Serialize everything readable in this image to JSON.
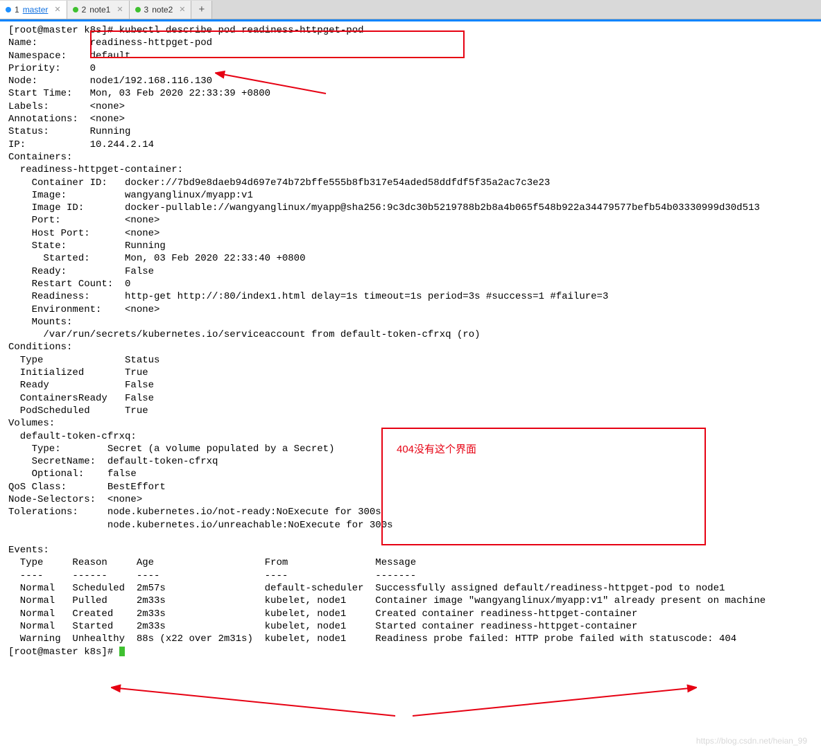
{
  "tabs": [
    {
      "num": "1",
      "title": "master",
      "active": true,
      "dot": "blue"
    },
    {
      "num": "2",
      "title": "note1",
      "active": false,
      "dot": "green"
    },
    {
      "num": "3",
      "title": "note2",
      "active": false,
      "dot": "green"
    }
  ],
  "term": {
    "prompt": "[root@master k8s]# ",
    "cmd": "kubectl describe pod readiness-httpget-pod",
    "body": "Name:         readiness-httpget-pod\nNamespace:    default\nPriority:     0\nNode:         node1/192.168.116.130\nStart Time:   Mon, 03 Feb 2020 22:33:39 +0800\nLabels:       <none>\nAnnotations:  <none>\nStatus:       Running\nIP:           10.244.2.14\nContainers:\n  readiness-httpget-container:\n    Container ID:   docker://7bd9e8daeb94d697e74b72bffe555b8fb317e54aded58ddfdf5f35a2ac7c3e23\n    Image:          wangyanglinux/myapp:v1\n    Image ID:       docker-pullable://wangyanglinux/myapp@sha256:9c3dc30b5219788b2b8a4b065f548b922a34479577befb54b03330999d30d513\n    Port:           <none>\n    Host Port:      <none>\n    State:          Running\n      Started:      Mon, 03 Feb 2020 22:33:40 +0800\n    Ready:          False\n    Restart Count:  0\n    Readiness:      http-get http://:80/index1.html delay=1s timeout=1s period=3s #success=1 #failure=3\n    Environment:    <none>\n    Mounts:\n      /var/run/secrets/kubernetes.io/serviceaccount from default-token-cfrxq (ro)\nConditions:\n  Type              Status\n  Initialized       True \n  Ready             False \n  ContainersReady   False \n  PodScheduled      True \nVolumes:\n  default-token-cfrxq:\n    Type:        Secret (a volume populated by a Secret)\n    SecretName:  default-token-cfrxq\n    Optional:    false\nQoS Class:       BestEffort\nNode-Selectors:  <none>\nTolerations:     node.kubernetes.io/not-ready:NoExecute for 300s\n                 node.kubernetes.io/unreachable:NoExecute for 300s\n",
    "events": "Events:\n  Type     Reason     Age                   From               Message\n  ----     ------     ----                  ----               -------\n  Normal   Scheduled  2m57s                 default-scheduler  Successfully assigned default/readiness-httpget-pod to node1\n  Normal   Pulled     2m33s                 kubelet, node1     Container image \"wangyanglinux/myapp:v1\" already present on machine\n  Normal   Created    2m33s                 kubelet, node1     Created container readiness-httpget-container\n  Normal   Started    2m33s                 kubelet, node1     Started container readiness-httpget-container\n  Warning  Unhealthy  88s (x22 over 2m31s)  kubelet, node1     Readiness probe failed: HTTP probe failed with statuscode: 404\n",
    "prompt2": "[root@master k8s]# "
  },
  "note": "404没有这个界面",
  "watermark": "https://blog.csdn.net/heian_99"
}
